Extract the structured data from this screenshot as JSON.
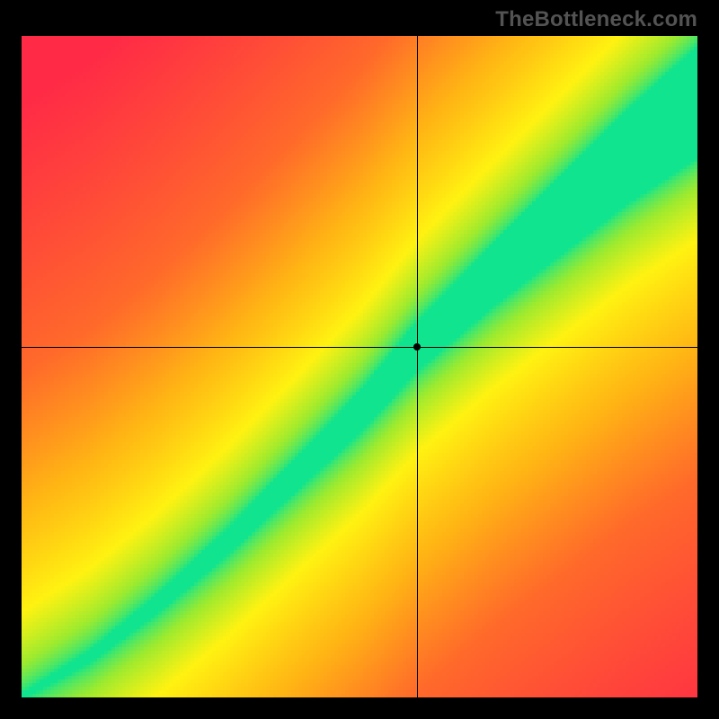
{
  "watermark": "TheBottleneck.com",
  "chart_data": {
    "type": "heatmap",
    "title": "",
    "xlabel": "",
    "ylabel": "",
    "xlim": [
      0,
      1
    ],
    "ylim": [
      0,
      1
    ],
    "grid": false,
    "crosshair": {
      "x": 0.585,
      "y": 0.53
    },
    "marker": {
      "x": 0.585,
      "y": 0.53
    },
    "ridge": {
      "description": "locus of minimum bottleneck (green) runs roughly along y = x^1.15 then flattens slightly toward the upper-right; band widens with x",
      "control_points": [
        {
          "x": 0.0,
          "y": 0.0,
          "half_width": 0.005
        },
        {
          "x": 0.1,
          "y": 0.06,
          "half_width": 0.01
        },
        {
          "x": 0.2,
          "y": 0.14,
          "half_width": 0.015
        },
        {
          "x": 0.3,
          "y": 0.23,
          "half_width": 0.02
        },
        {
          "x": 0.4,
          "y": 0.33,
          "half_width": 0.025
        },
        {
          "x": 0.5,
          "y": 0.43,
          "half_width": 0.032
        },
        {
          "x": 0.585,
          "y": 0.53,
          "half_width": 0.038
        },
        {
          "x": 0.7,
          "y": 0.64,
          "half_width": 0.048
        },
        {
          "x": 0.8,
          "y": 0.73,
          "half_width": 0.06
        },
        {
          "x": 0.9,
          "y": 0.82,
          "half_width": 0.072
        },
        {
          "x": 1.0,
          "y": 0.9,
          "half_width": 0.085
        }
      ]
    },
    "color_scale": {
      "description": "distance from ridge mapped through green→yellow→orange→red",
      "stops": [
        {
          "t": 0.0,
          "color": "#10e48e"
        },
        {
          "t": 0.12,
          "color": "#9cea2f"
        },
        {
          "t": 0.25,
          "color": "#fff211"
        },
        {
          "t": 0.45,
          "color": "#ffb414"
        },
        {
          "t": 0.65,
          "color": "#ff6a2a"
        },
        {
          "t": 1.0,
          "color": "#ff2a46"
        }
      ]
    },
    "resolution": {
      "w": 188,
      "h": 184
    }
  }
}
